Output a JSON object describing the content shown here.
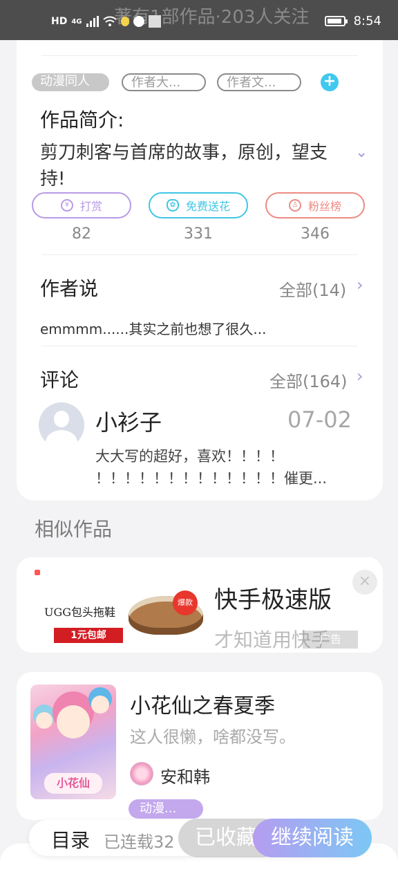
{
  "status_bar": {
    "overlay_text": "著有1部作品·203人关注",
    "hd": "HD",
    "net": "4G",
    "time": "8:54"
  },
  "tags": [
    "动漫同人",
    "作者大...",
    "作者文..."
  ],
  "intro": {
    "title": "作品简介:",
    "text": "剪刀刺客与首席的故事，原创，望支持!"
  },
  "actions": [
    {
      "label": "打赏",
      "count": "82",
      "icon": "yen-icon",
      "color": "#b99ae6"
    },
    {
      "label": "免费送花",
      "count": "331",
      "icon": "flower-icon",
      "color": "#3fc6e6"
    },
    {
      "label": "粉丝榜",
      "count": "346",
      "icon": "fans-icon",
      "color": "#ec8a83"
    }
  ],
  "author_says": {
    "title": "作者说",
    "all": "全部(14)",
    "text": "emmmm......其实之前也想了很久..."
  },
  "comments": {
    "title": "评论",
    "all": "全部(164)",
    "user": "小衫子",
    "date": "07-02",
    "text1": "大大写的超好，喜欢！！！！",
    "text2": "！！！！！！！！！！！！！催更..."
  },
  "similar_title": "相似作品",
  "ad": {
    "product": "UGG包头拖鞋",
    "promo": "1元包邮",
    "hot": "爆款",
    "title": "快手极速版",
    "subtitle": "才知道用快手",
    "label": "广告",
    "close": "×"
  },
  "book": {
    "title": "小花仙之春夏季",
    "desc": "这人很懒，啥都没写。",
    "author": "安和韩",
    "genre": "动漫...",
    "cover_logo": "小花仙"
  },
  "bottom": {
    "catalog": "目录",
    "serial": "已连载32",
    "fav": "已收藏",
    "continue": "继续阅读"
  }
}
